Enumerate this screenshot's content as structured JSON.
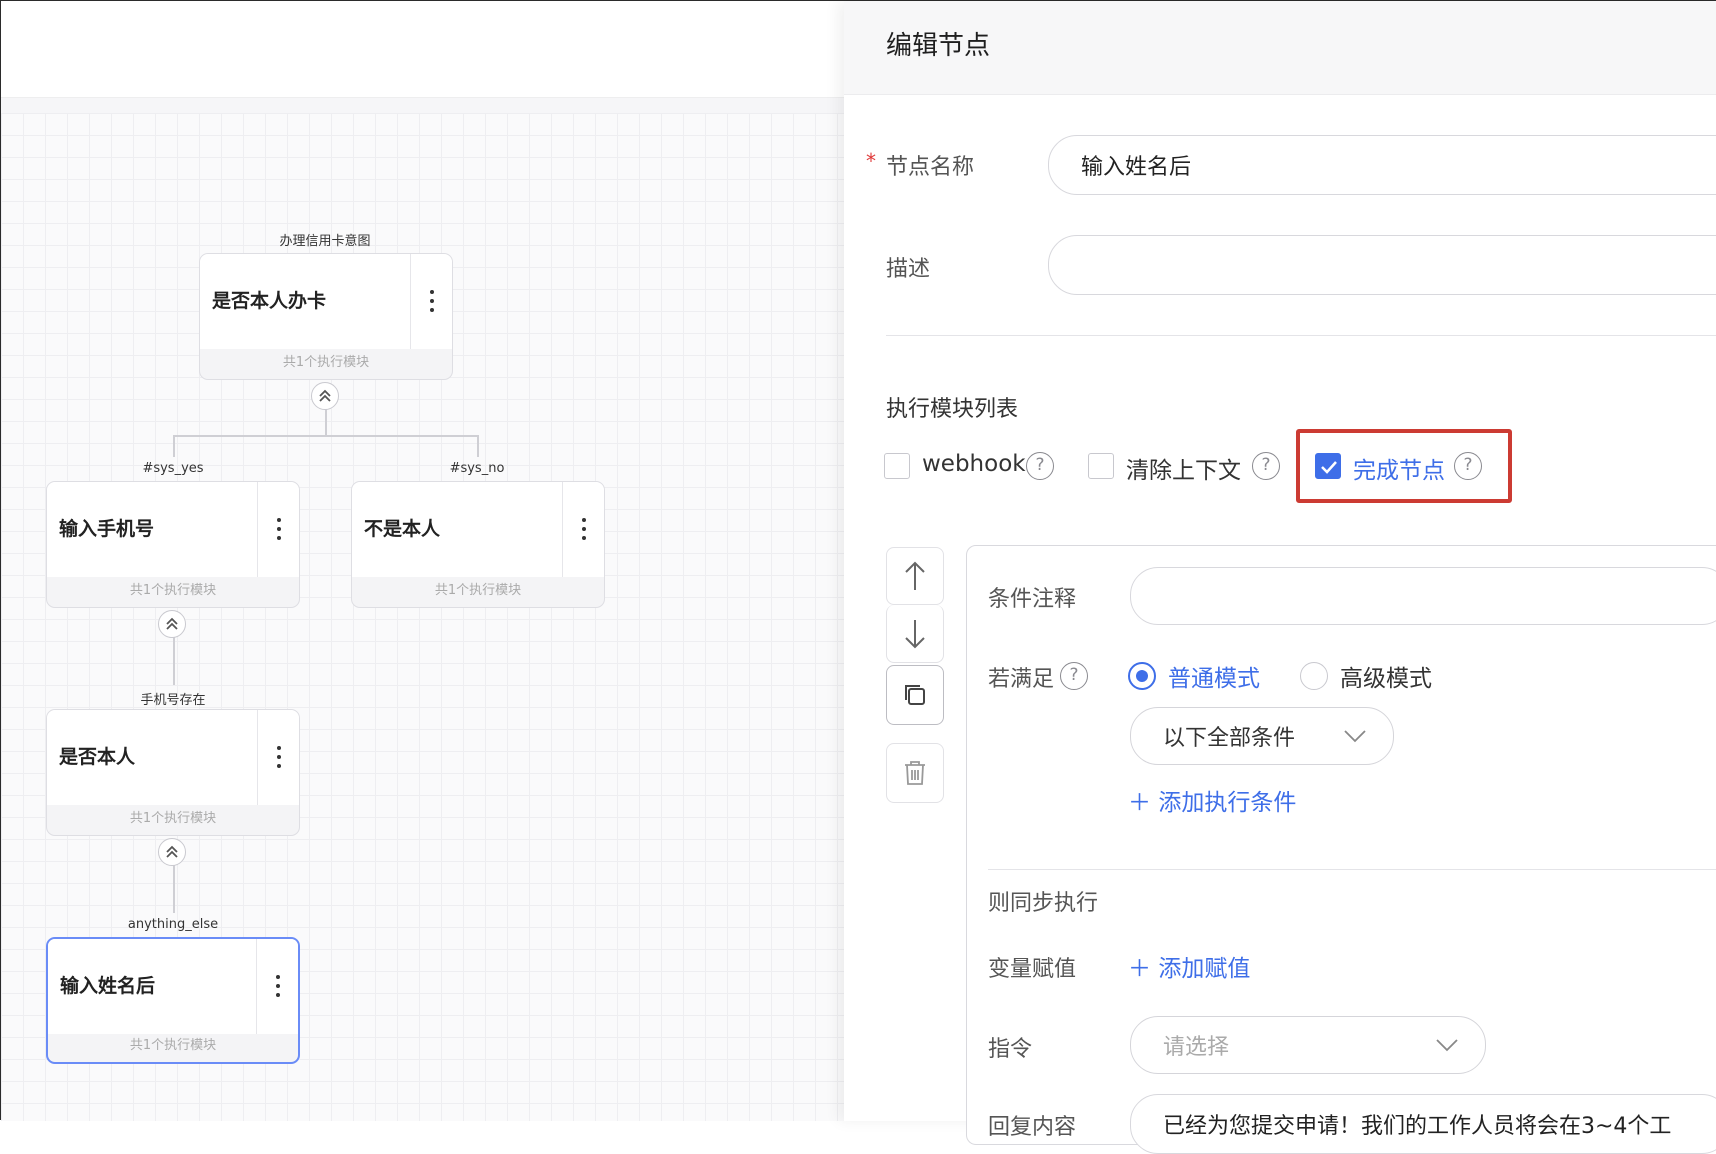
{
  "colors": {
    "accent": "#3e6ee8",
    "highlight": "#cc3b33",
    "required": "#e03a3a"
  },
  "flow": {
    "edge_labels": {
      "root": "办理信用卡意图",
      "yes": "#sys_yes",
      "no": "#sys_no",
      "phone_exists": "手机号存在",
      "anything_else": "anything_else"
    },
    "nodes": {
      "root": {
        "title": "是否本人办卡",
        "footer": "共1个执行模块"
      },
      "phone": {
        "title": "输入手机号",
        "footer": "共1个执行模块"
      },
      "not_self": {
        "title": "不是本人",
        "footer": "共1个执行模块"
      },
      "is_self": {
        "title": "是否本人",
        "footer": "共1个执行模块"
      },
      "after_name": {
        "title": "输入姓名后",
        "footer": "共1个执行模块"
      }
    }
  },
  "panel": {
    "title": "编辑节点",
    "name_label": "节点名称",
    "name_value": "输入姓名后",
    "desc_label": "描述",
    "desc_value": "",
    "modules_title": "执行模块列表",
    "options": {
      "webhook": {
        "label": "webhook",
        "checked": false
      },
      "clear_context": {
        "label": "清除上下文",
        "checked": false
      },
      "complete_node": {
        "label": "完成节点",
        "checked": true
      }
    },
    "condition": {
      "note_label": "条件注释",
      "note_value": "",
      "if_label": "若满足",
      "mode_normal": "普通模式",
      "mode_advanced": "高级模式",
      "match_select": "以下全部条件",
      "add_condition": "添加执行条件",
      "then_label": "则同步执行",
      "assign_label": "变量赋值",
      "add_assign": "添加赋值",
      "command_label": "指令",
      "command_placeholder": "请选择",
      "reply_label": "回复内容",
      "reply_value": "已经为您提交申请！我们的工作人员将会在3~4个工"
    }
  }
}
